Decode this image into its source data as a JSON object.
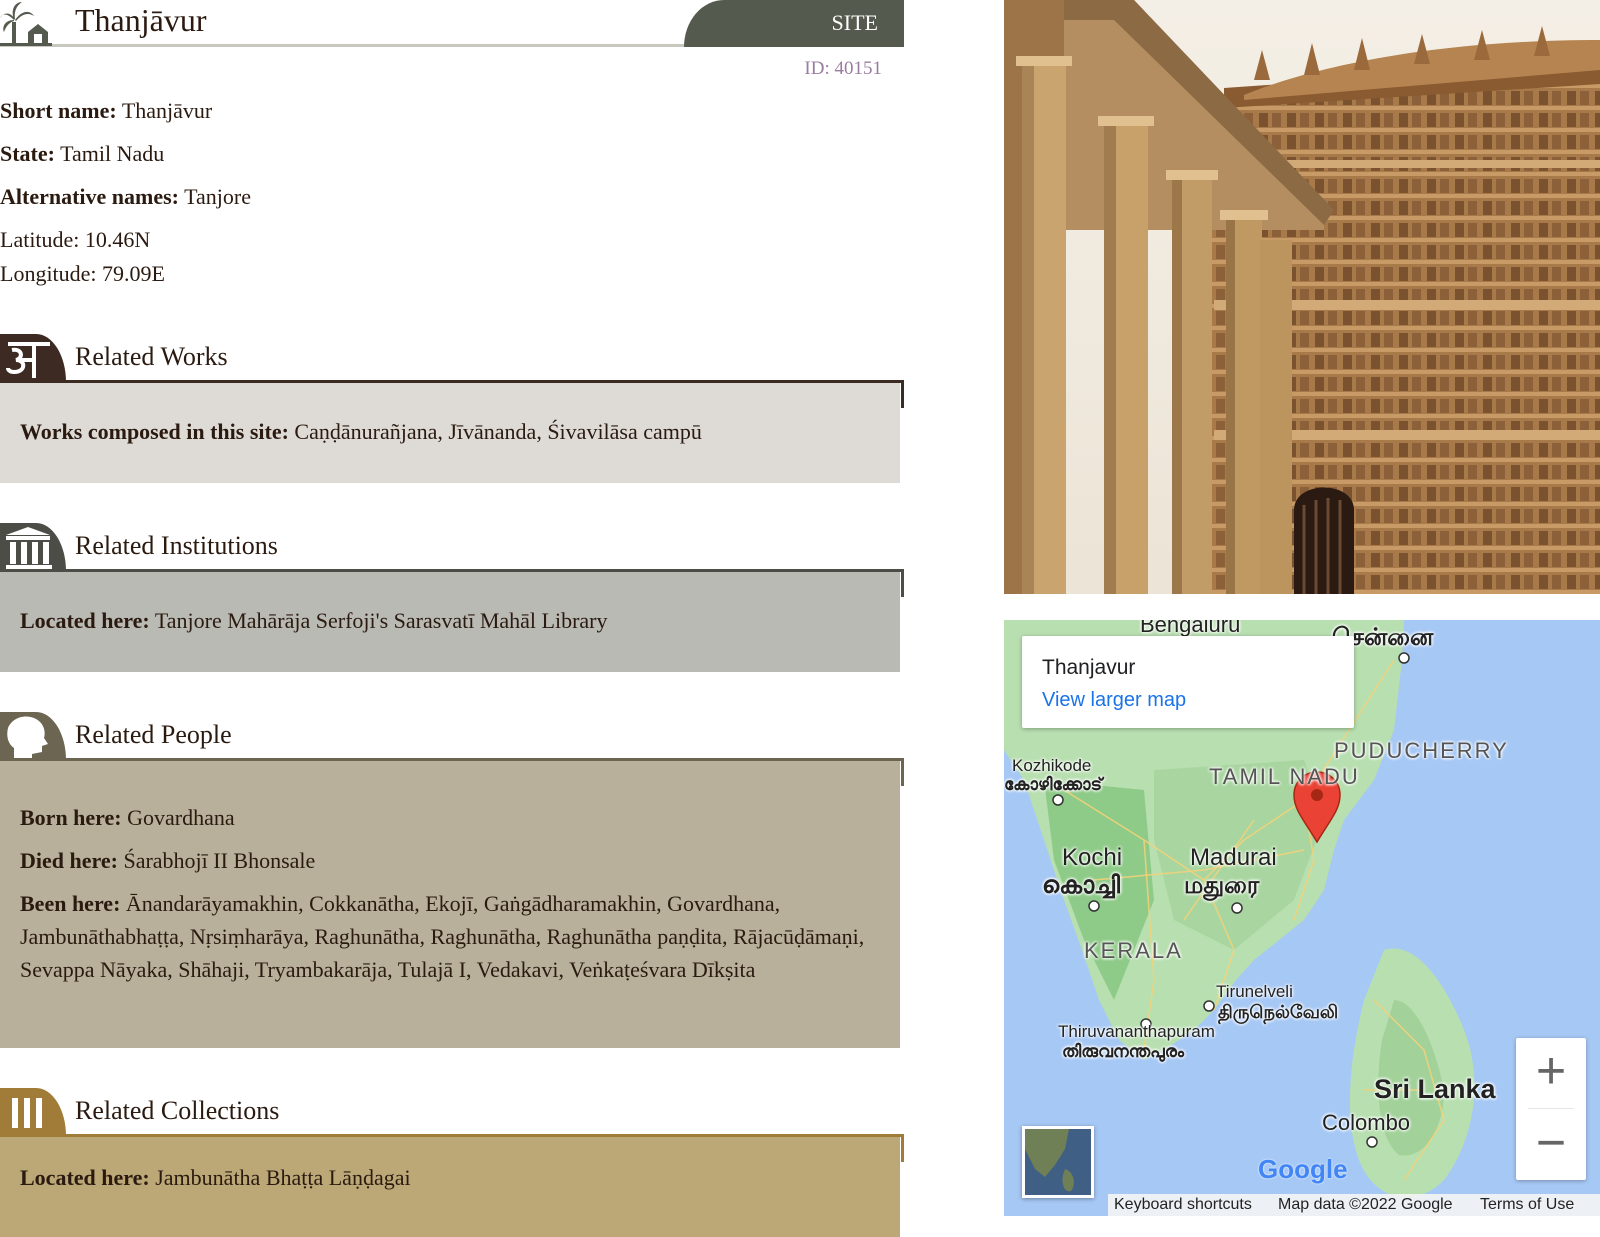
{
  "header": {
    "title": "Thanjāvur",
    "badge": "SITE",
    "id_text": "ID: 40151"
  },
  "fields": {
    "short_name_label": "Short name:",
    "short_name_value": "Thanjāvur",
    "state_label": "State:",
    "state_value": "Tamil Nadu",
    "alt_names_label": "Alternative names:",
    "alt_names_value": "Tanjore",
    "latitude": "Latitude: 10.46N",
    "longitude": "Longitude: 79.09E"
  },
  "sections": {
    "works": {
      "title": "Related Works",
      "label": "Works composed in this site:",
      "value": "Caṇḍānurañjana, Jīvānanda, Śivavilāsa campū",
      "color": "#dedad6",
      "icon_color": "#3d2a22"
    },
    "institutions": {
      "title": "Related Institutions",
      "label": "Located here:",
      "value": "Tanjore Mahārāja Serfoji's Sarasvatī Mahāl Library",
      "color": "#babab4",
      "icon_color": "#4d4d48"
    },
    "people": {
      "title": "Related People",
      "born_label": "Born here:",
      "born_value": "Govardhana",
      "died_label": "Died here:",
      "died_value": "Śarabhojī II Bhonsale",
      "been_label": "Been here:",
      "been_value": "Ānandarāyamakhin, Cokkanātha, Ekojī, Gaṅgādharamakhin, Govardhana, Jambunāthabhaṭṭa, Nṛsiṃharāya, Raghunātha, Raghunātha, Raghunātha paṇḍita, Rājacūḍāmaṇi, Sevappa Nāyaka, Shāhaji, Tryambakarāja, Tulajā I, Vedakavi, Veṅkaṭeśvara Dīkṣita",
      "color": "#b8b09a",
      "icon_color": "#6b6552"
    },
    "collections": {
      "title": "Related Collections",
      "label": "Located here:",
      "value": "Jambunātha Bhaṭṭa Lāṇḍagai",
      "color": "#bca876",
      "icon_color": "#a07c38"
    }
  },
  "map": {
    "info_title": "Thanjavur",
    "info_link": "View larger map",
    "labels": {
      "bengaluru": "Bengaluru",
      "chennai_ta": "சென்னை",
      "puducherry": "PUDUCHERRY",
      "tamil_nadu": "TAMIL NADU",
      "kozhikode": "Kozhikode",
      "kozhikode_ml": "കോഴിക്കോട്",
      "kochi": "Kochi",
      "kochi_ml": "കൊച്ചി",
      "madurai": "Madurai",
      "madurai_ta": "மதுரை",
      "kerala": "KERALA",
      "tirunelveli": "Tirunelveli",
      "tirunelveli_ta": "திருநெல்வேலி",
      "thiruvananthapuram": "Thiruvananthapuram",
      "thiruvananthapuram_ml": "തിരുവനന്തപുരം",
      "sri_lanka": "Sri Lanka",
      "colombo": "Colombo",
      "google": "Google"
    },
    "zoom_in": "+",
    "zoom_out": "−",
    "footer": {
      "shortcuts": "Keyboard shortcuts",
      "map_data": "Map data ©2022 Google",
      "terms": "Terms of Use"
    }
  }
}
